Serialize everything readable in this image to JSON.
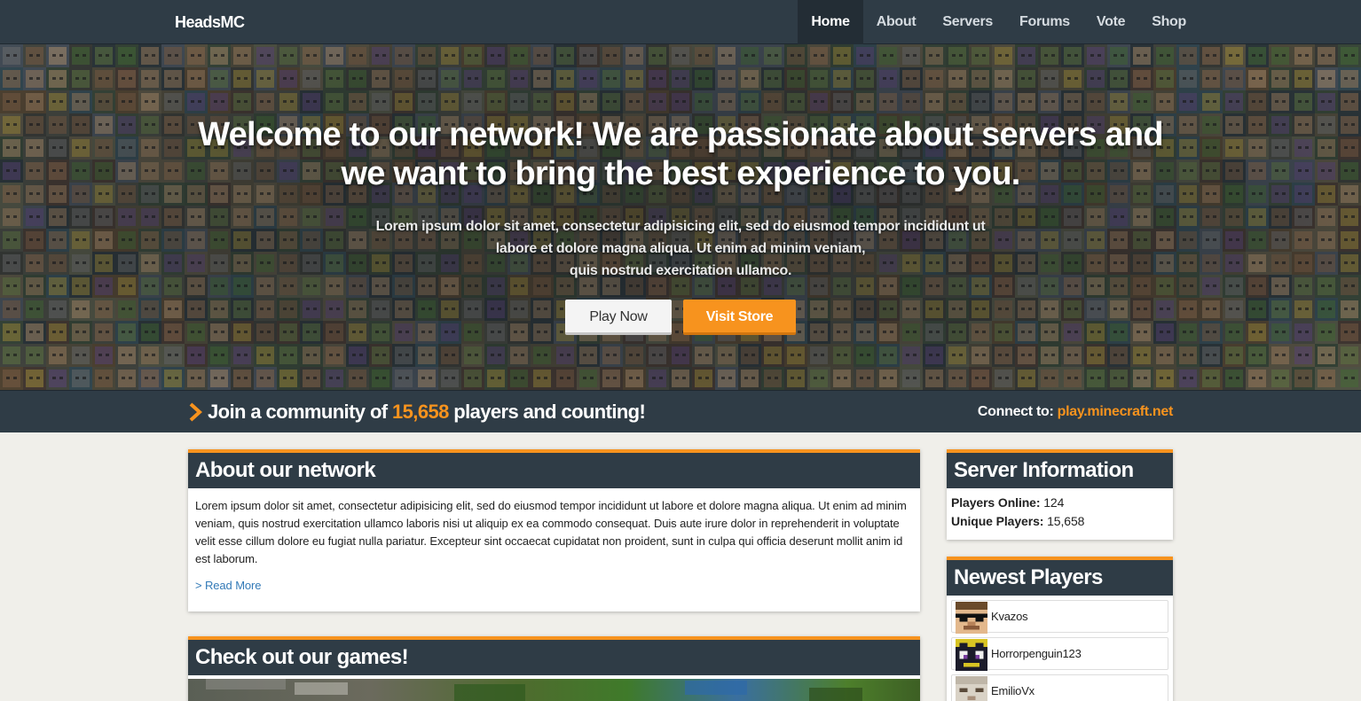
{
  "navbar": {
    "brand": "HeadsMC",
    "items": [
      {
        "label": "Home",
        "active": true
      },
      {
        "label": "About",
        "active": false
      },
      {
        "label": "Servers",
        "active": false
      },
      {
        "label": "Forums",
        "active": false
      },
      {
        "label": "Vote",
        "active": false
      },
      {
        "label": "Shop",
        "active": false
      }
    ]
  },
  "hero": {
    "headline": "Welcome to our network! We are passionate about servers and we want to bring the best experience to you.",
    "lead_line1": "Lorem ipsum dolor sit amet, consectetur adipisicing elit, sed do eiusmod tempor incididunt ut",
    "lead_line2": "labore et dolore magna aliqua. Ut enim ad minim veniam,",
    "lead_line3": "quis nostrud exercitation ullamco.",
    "play_button": "Play Now",
    "store_button": "Visit Store"
  },
  "strip": {
    "join_prefix": "Join a community of",
    "player_count": "15,658",
    "join_suffix": "players and counting!",
    "connect_label": "Connect to:",
    "server_address": "play.minecraft.net"
  },
  "about": {
    "title": "About our network",
    "body": "Lorem ipsum dolor sit amet, consectetur adipisicing elit, sed do eiusmod tempor incididunt ut labore et dolore magna aliqua. Ut enim ad minim veniam, quis nostrud exercitation ullamco laboris nisi ut aliquip ex ea commodo consequat. Duis aute irure dolor in reprehenderit in voluptate velit esse cillum dolore eu fugiat nulla pariatur. Excepteur sint occaecat cupidatat non proident, sunt in culpa qui officia deserunt mollit anim id est laborum.",
    "read_more": "> Read More"
  },
  "games": {
    "title": "Check out our games!"
  },
  "server_info": {
    "title": "Server Information",
    "players_online_label": "Players Online:",
    "players_online": "124",
    "unique_players_label": "Unique Players:",
    "unique_players": "15,658"
  },
  "newest_players": {
    "title": "Newest Players",
    "players": [
      {
        "name": "Kvazos",
        "avatar": "sunglasses-face-icon"
      },
      {
        "name": "Horrorpenguin123",
        "avatar": "crowned-face-icon"
      },
      {
        "name": "EmilioVx",
        "avatar": "pale-face-icon"
      }
    ]
  },
  "colors": {
    "navbar": "#2f3c46",
    "accent": "#f7931e",
    "link": "#337ab7",
    "page_bg": "#f0efea"
  }
}
